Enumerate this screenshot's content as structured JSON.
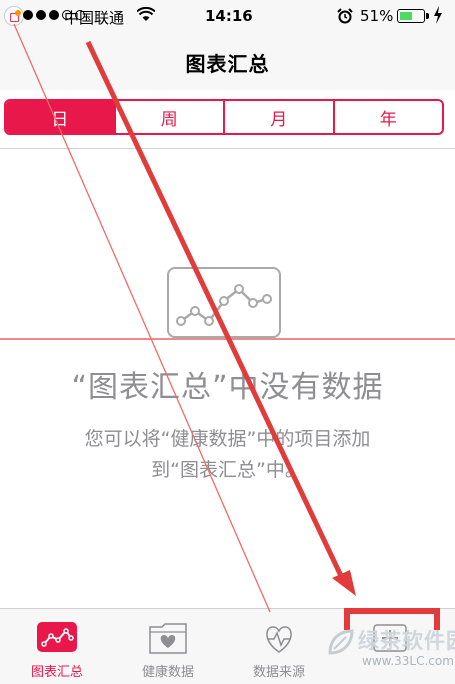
{
  "status_bar": {
    "carrier": "中国联通",
    "time": "14:16",
    "battery_percent": "51%",
    "battery_level": 0.51,
    "signal_bars": 3,
    "signal_total": 5,
    "icons": [
      "signal-dots-icon",
      "wifi-icon",
      "alarm-clock-icon",
      "battery-icon",
      "charging-bolt-icon"
    ]
  },
  "nav": {
    "title": "图表汇总"
  },
  "segments": {
    "items": [
      {
        "label": "日",
        "active": true
      },
      {
        "label": "周",
        "active": false
      },
      {
        "label": "月",
        "active": false
      },
      {
        "label": "年",
        "active": false
      }
    ]
  },
  "empty_state": {
    "icon": "line-chart-icon",
    "title": "“图表汇总”中没有数据",
    "description_line1": "您可以将“健康数据”中的项目添加",
    "description_line2": "到“图表汇总”中。"
  },
  "tab_bar": {
    "items": [
      {
        "label": "图表汇总",
        "icon": "dashboard-chart-icon",
        "active": true
      },
      {
        "label": "健康数据",
        "icon": "folder-heart-icon",
        "active": false
      },
      {
        "label": "数据来源",
        "icon": "heart-source-icon",
        "active": false
      },
      {
        "label": "",
        "icon": "medical-id-icon",
        "active": false
      }
    ]
  },
  "watermark": {
    "text": "绿茶软件园",
    "url": "www.33LC.com"
  },
  "colors": {
    "accent": "#e8184b",
    "annotation": "#e23b3b",
    "secondary_text": "#8e8e93",
    "bar_background": "#f7f7f8"
  }
}
